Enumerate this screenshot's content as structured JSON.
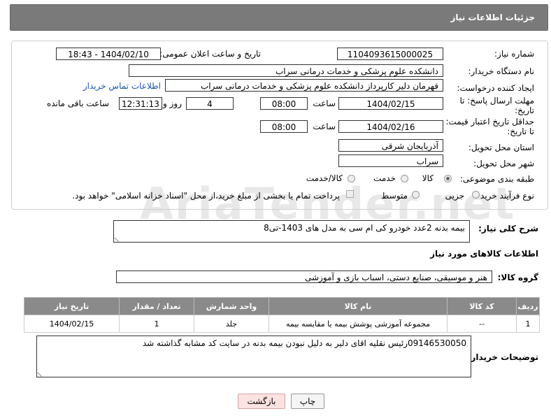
{
  "header": {
    "title": "جزئیات اطلاعات نیاز"
  },
  "form": {
    "need_number_label": "شماره نیاز:",
    "need_number": "1104093615000025",
    "announce_label": "تاریخ و ساعت اعلان عمومی:",
    "announce_value": "1404/02/10 - 18:43",
    "buyer_org_label": "نام دستگاه خریدار:",
    "buyer_org": "دانشکده علوم پزشکی و خدمات درمانی سراب",
    "creator_label": "ایجاد کننده درخواست:",
    "creator": "قهرمان دلیر کارپرداز دانشکده علوم پزشکی و خدمات درمانی سراب",
    "contact_link": "اطلاعات تماس خریدار",
    "reply_deadline_label_1": "مهلت ارسال پاسخ: تا",
    "reply_deadline_label_2": "تاریخ:",
    "reply_date": "1404/02/15",
    "time_label": "ساعت",
    "reply_time": "08:00",
    "days_value": "4",
    "days_label": "روز و",
    "remaining_time": "12:31:13",
    "remaining_label": "ساعت باقی مانده",
    "price_deadline_label_1": "حداقل تاریخ اعتبار قیمت:",
    "price_deadline_label_2": "تا تاریخ:",
    "price_date": "1404/02/16",
    "price_time": "08:00",
    "province_label": "استان محل تحویل:",
    "province": "آذربایجان شرقی",
    "city_label": "شهر محل تحویل:",
    "city": "سراب",
    "category_label": "طبقه بندی موضوعی:",
    "category_options": [
      "کالا",
      "خدمت",
      "کالا/خدمت"
    ],
    "process_label": "نوع فرآیند خرید :",
    "process_options": [
      "جزیی",
      "متوسط"
    ],
    "payment_note": "پرداخت تمام یا بخشی از مبلغ خرید،از محل \"اسناد خزانه اسلامی\" خواهد بود."
  },
  "description": {
    "label": "شرح کلی نیاز:",
    "value": "بیمه بدنه 2عدد خودرو کی ام سی به مدل های 1403-تی8"
  },
  "goods": {
    "section_title": "اطلاعات کالاهای مورد نیاز",
    "group_label": "گروه کالا:",
    "group_value": "هنر و موسیقی، صنایع دستی، اسباب بازی و آموزشی",
    "columns": [
      "ردیف",
      "کد کالا",
      "نام کالا",
      "واحد شمارش",
      "تعداد / مقدار",
      "تاریخ نیاز"
    ],
    "rows": [
      [
        "1",
        "--",
        "مجموعه آموزشی پوشش بیمه یا مقایسه بیمه",
        "جلد",
        "1",
        "1404/02/15"
      ]
    ]
  },
  "buyer_notes": {
    "label": "توضیحات خریدار:",
    "value": "09146530050رئیس نقلیه اقای دلیر به دلیل نبودن بیمه بدنه در سایت کد مشابه گذاشته شد"
  },
  "buttons": {
    "print": "چاپ",
    "back": "بازگشت"
  },
  "watermark": "AriaTender.net"
}
